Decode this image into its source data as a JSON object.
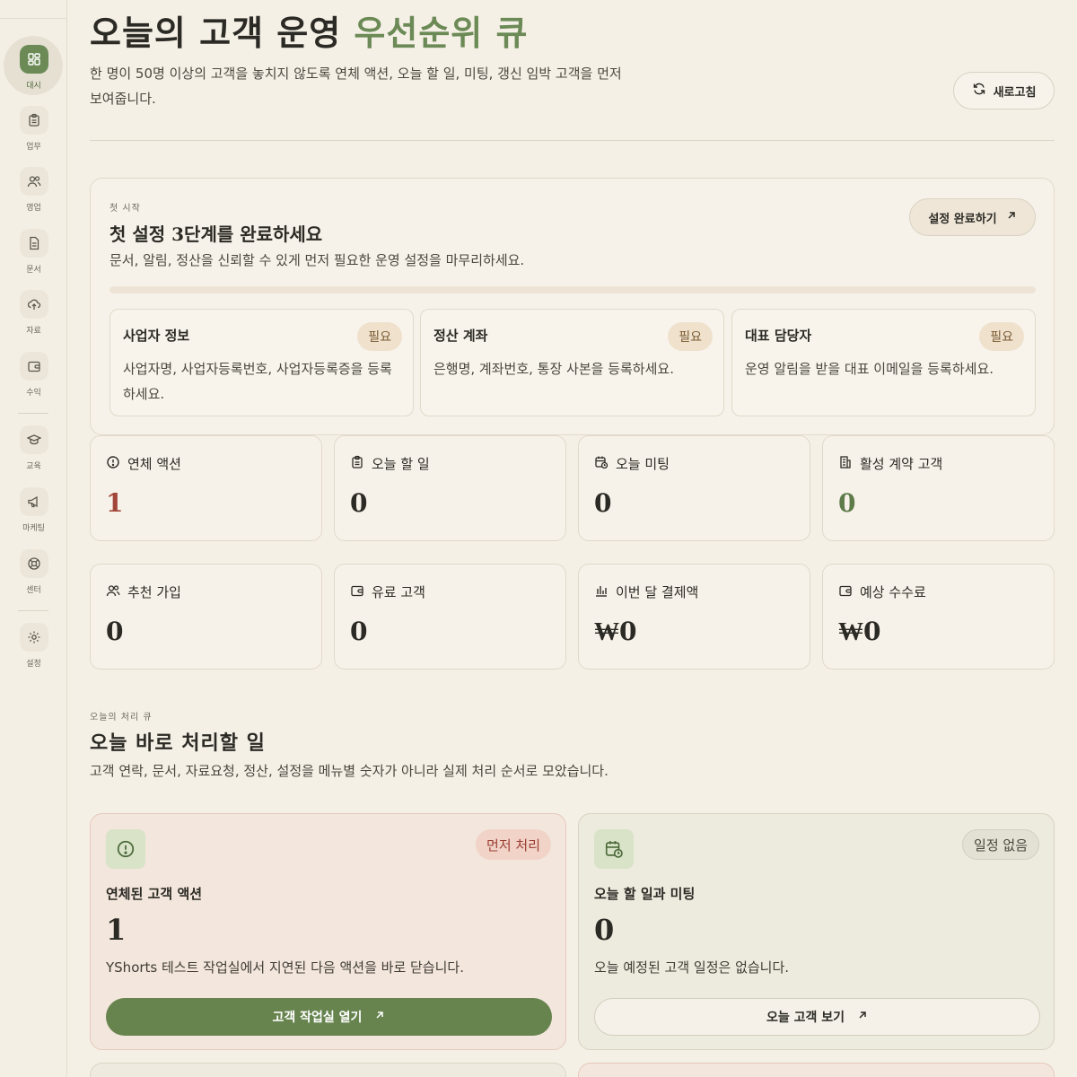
{
  "sidebar": {
    "items": [
      {
        "label": "대시",
        "icon": "dashboard-icon"
      },
      {
        "label": "업무",
        "icon": "clipboard-icon"
      },
      {
        "label": "영업",
        "icon": "users-icon"
      },
      {
        "label": "문서",
        "icon": "document-icon"
      },
      {
        "label": "자료",
        "icon": "upload-cloud-icon"
      },
      {
        "label": "수익",
        "icon": "wallet-icon"
      },
      {
        "label": "교육",
        "icon": "graduation-cap-icon"
      },
      {
        "label": "마케팅",
        "icon": "megaphone-icon"
      },
      {
        "label": "센터",
        "icon": "lifebuoy-icon"
      },
      {
        "label": "설정",
        "icon": "gear-icon"
      }
    ]
  },
  "header": {
    "title_main": "오늘의 고객 운영",
    "title_accent": "우선순위 큐",
    "description": "한 명이 50명 이상의 고객을 놓치지 않도록 연체 액션, 오늘 할 일, 미팅, 갱신 임박 고객을 먼저 보여줍니다.",
    "refresh_label": "새로고침"
  },
  "setup": {
    "eyebrow": "첫 시작",
    "title": "첫 설정 3단계를 완료하세요",
    "description": "문서, 알림, 정산을 신뢰할 수 있게 먼저 필요한 운영 설정을 마무리하세요.",
    "button_label": "설정 완료하기",
    "progress": 0,
    "steps": [
      {
        "title": "사업자 정보",
        "badge": "필요",
        "description": "사업자명, 사업자등록번호, 사업자등록증을 등록하세요."
      },
      {
        "title": "정산 계좌",
        "badge": "필요",
        "description": "은행명, 계좌번호, 통장 사본을 등록하세요."
      },
      {
        "title": "대표 담당자",
        "badge": "필요",
        "description": "운영 알림을 받을 대표 이메일을 등록하세요."
      }
    ]
  },
  "stats": [
    {
      "label": "연체 액션",
      "value": "1",
      "icon": "alert-circle-icon",
      "color": "#a3463a"
    },
    {
      "label": "오늘 할 일",
      "value": "0",
      "icon": "clipboard-icon",
      "color": "#2b2a24"
    },
    {
      "label": "오늘 미팅",
      "value": "0",
      "icon": "calendar-clock-icon",
      "color": "#2b2a24"
    },
    {
      "label": "활성 계약 고객",
      "value": "0",
      "icon": "building-icon",
      "color": "#5d7c49"
    },
    {
      "label": "추천 가입",
      "value": "0",
      "icon": "users-icon",
      "color": "#2b2a24"
    },
    {
      "label": "유료 고객",
      "value": "0",
      "icon": "wallet-icon",
      "color": "#2b2a24"
    },
    {
      "label": "이번 달 결제액",
      "value": "₩0",
      "icon": "bar-chart-icon",
      "color": "#2b2a24"
    },
    {
      "label": "예상 수수료",
      "value": "₩0",
      "icon": "wallet-icon",
      "color": "#2b2a24"
    }
  ],
  "queue": {
    "eyebrow": "오늘의 처리 큐",
    "title": "오늘 바로 처리할 일",
    "description": "고객 연락, 문서, 자료요청, 정산, 설정을 메뉴별 숫자가 아니라 실제 처리 순서로 모았습니다.",
    "cards": [
      {
        "badge": "먼저 처리",
        "title": "연체된 고객 액션",
        "value": "1",
        "description": "YShorts 테스트 작업실에서 지연된 다음 액션을 바로 닫습니다.",
        "button_label": "고객 작업실 열기",
        "icon": "alert-circle-icon"
      },
      {
        "badge": "일정 없음",
        "title": "오늘 할 일과 미팅",
        "value": "0",
        "description": "오늘 예정된 고객 일정은 없습니다.",
        "button_label": "오늘 고객 보기",
        "icon": "calendar-clock-icon"
      }
    ]
  }
}
